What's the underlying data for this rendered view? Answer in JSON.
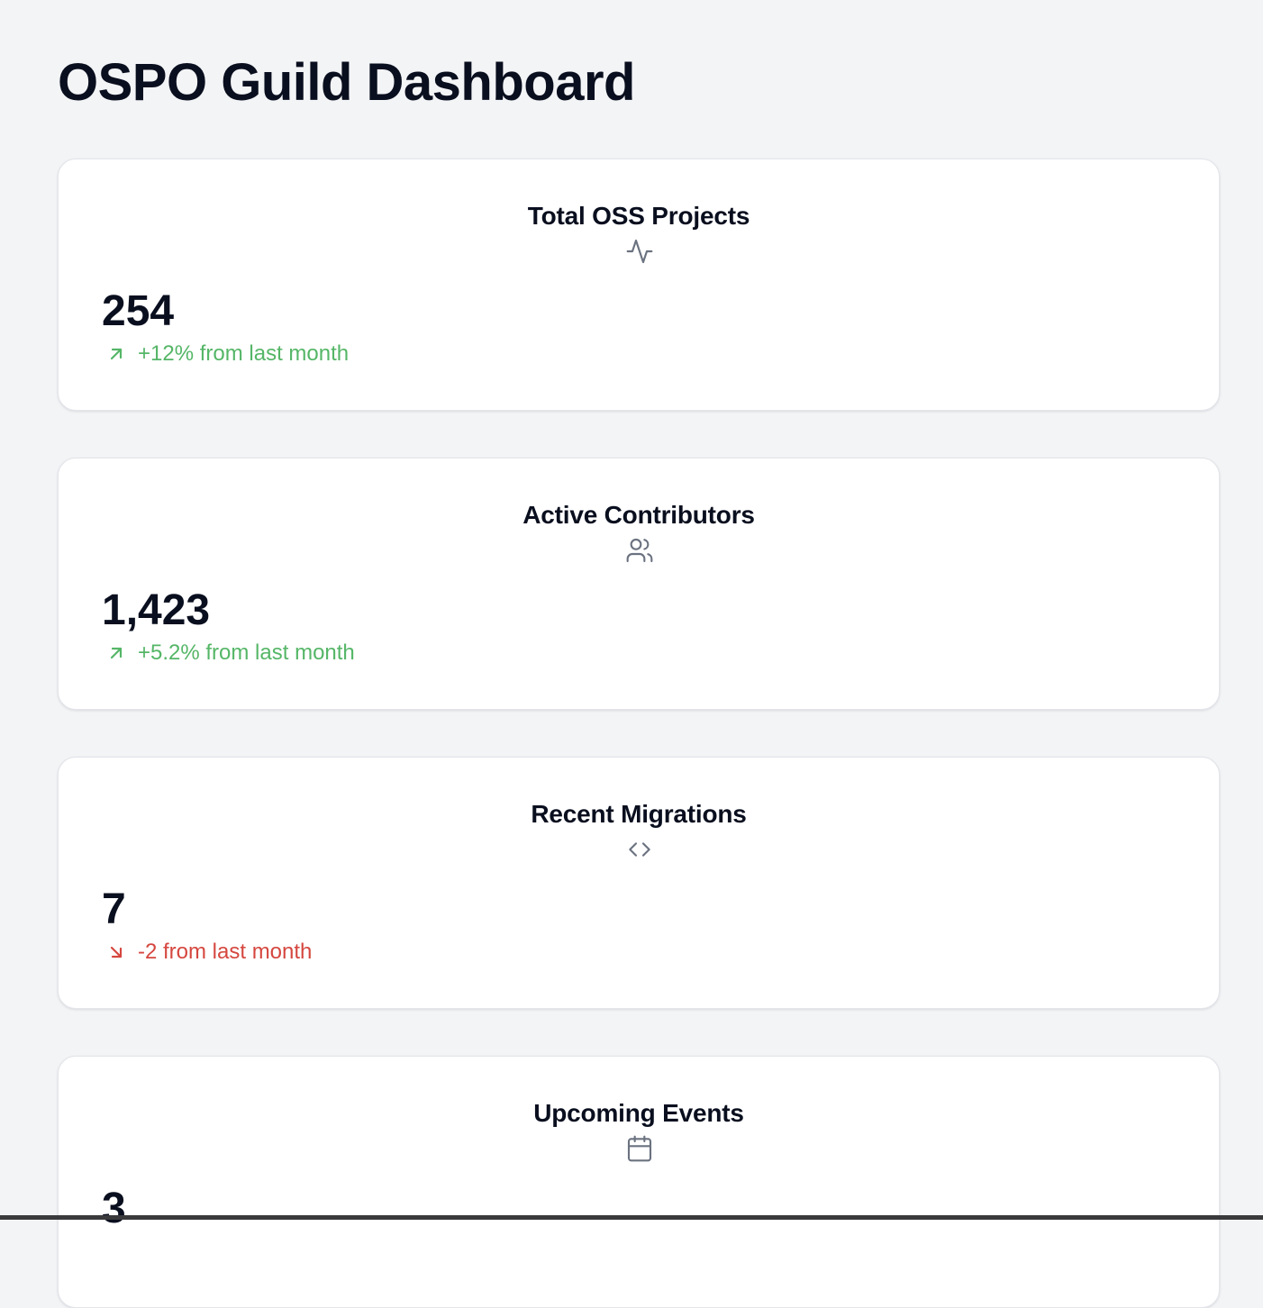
{
  "page": {
    "title": "OSPO Guild Dashboard"
  },
  "colors": {
    "background": "#f3f4f6",
    "card": "#ffffff",
    "positive": "#55b667",
    "negative": "#d5473f",
    "icon": "#6b7280"
  },
  "cards": [
    {
      "title": "Total OSS Projects",
      "icon": "activity-icon",
      "value": "254",
      "change": "+12% from last month",
      "trend": "up",
      "trend_icon": "arrow-up-right-icon"
    },
    {
      "title": "Active Contributors",
      "icon": "users-icon",
      "value": "1,423",
      "change": "+5.2% from last month",
      "trend": "up",
      "trend_icon": "arrow-up-right-icon"
    },
    {
      "title": "Recent Migrations",
      "icon": "code-icon",
      "value": "7",
      "change": "-2 from last month",
      "trend": "down",
      "trend_icon": "arrow-down-right-icon"
    },
    {
      "title": "Upcoming Events",
      "icon": "calendar-icon",
      "value": "3"
    }
  ]
}
